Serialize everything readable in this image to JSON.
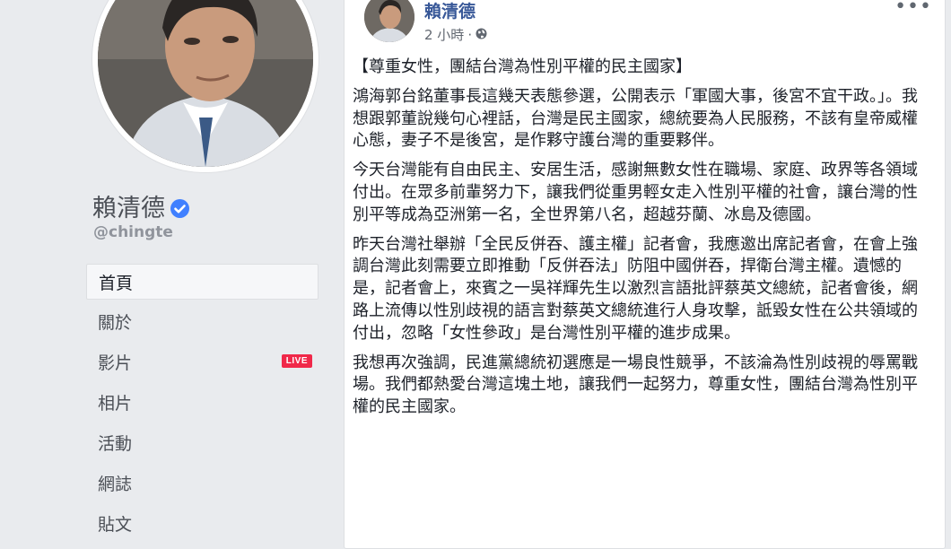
{
  "sidebar": {
    "page_name": "賴清德",
    "handle": "@chingte",
    "nav_items": [
      {
        "label": "首頁",
        "active": true
      },
      {
        "label": "關於"
      },
      {
        "label": "影片",
        "badge": "LIVE"
      },
      {
        "label": "相片"
      },
      {
        "label": "活動"
      },
      {
        "label": "網誌"
      },
      {
        "label": "貼文"
      }
    ],
    "verified_icon": "verified-check-icon",
    "badge_color": "#f02849"
  },
  "post": {
    "author": "賴清德",
    "time": "2 小時",
    "separator": "·",
    "audience_icon": "globe-icon",
    "more_icon": "•••",
    "title": "【尊重女性，團結台灣為性別平權的民主國家】",
    "paragraphs": [
      "鴻海郭台銘董事長這幾天表態參選，公開表示「軍國大事，後宮不宜干政。」。我想跟郭董說幾句心裡話，台灣是民主國家，總統要為人民服務，不該有皇帝威權心態，妻子不是後宮，是作夥守護台灣的重要夥伴。",
      "今天台灣能有自由民主、安居生活，感謝無數女性在職場、家庭、政界等各領域付出。在眾多前輩努力下，讓我們從重男輕女走入性別平權的社會，讓台灣的性別平等成為亞洲第一名，全世界第八名，超越芬蘭、冰島及德國。",
      "昨天台灣社舉辦「全民反併吞、護主權」記者會，我應邀出席記者會，在會上強調台灣此刻需要立即推動「反併吞法」防阻中國併吞，捍衛台灣主權。遺憾的是，記者會上，來賓之一吳祥輝先生以激烈言語批評蔡英文總統，記者會後，網路上流傳以性別歧視的語言對蔡英文總統進行人身攻擊，詆毀女性在公共領域的付出，忽略「女性參政」是台灣性別平權的進步成果。",
      "我想再次強調，民進黨總統初選應是一場良性競爭，不該淪為性別歧視的辱罵戰場。我們都熱愛台灣這塊土地，讓我們一起努力，尊重女性，團結台灣為性別平權的民主國家。"
    ]
  },
  "colors": {
    "link": "#385898",
    "verified": "#4080ff",
    "background": "#e9ebee"
  }
}
